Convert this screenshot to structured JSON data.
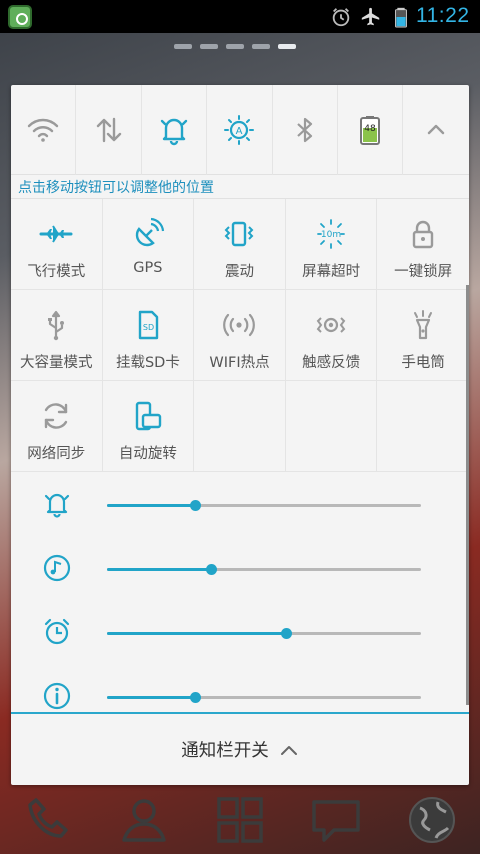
{
  "status_bar": {
    "time": "11:22",
    "icons": [
      "alarm-icon",
      "airplane-mode-icon",
      "battery-icon"
    ],
    "app_icon": "notification-app-icon"
  },
  "pager": {
    "pages": 5,
    "active_index": 4
  },
  "quick_toggles": [
    {
      "name": "wifi-toggle",
      "icon": "wifi-icon",
      "active": false
    },
    {
      "name": "data-sync-toggle",
      "icon": "mobile-data-icon",
      "active": false
    },
    {
      "name": "ringtone-toggle",
      "icon": "bell-icon",
      "active": true
    },
    {
      "name": "auto-brightness-toggle",
      "icon": "auto-brightness-icon",
      "active": true
    },
    {
      "name": "bluetooth-toggle",
      "icon": "bluetooth-icon",
      "active": false
    },
    {
      "name": "battery-toggle",
      "icon": "battery-icon",
      "value": "48"
    },
    {
      "name": "collapse-toggle",
      "icon": "chevron-up-icon"
    }
  ],
  "hint_text": "点击移动按钮可以调整他的位置",
  "tiles": [
    {
      "label": "飞行模式",
      "icon": "airplane-icon",
      "active": true
    },
    {
      "label": "GPS",
      "icon": "satellite-icon",
      "active": true
    },
    {
      "label": "震动",
      "icon": "vibrate-icon",
      "active": true
    },
    {
      "label": "屏幕超时",
      "icon": "screen-timeout-icon",
      "active": true,
      "badge": "10m"
    },
    {
      "label": "一键锁屏",
      "icon": "lock-icon",
      "active": false
    },
    {
      "label": "大容量模式",
      "icon": "usb-icon",
      "active": false
    },
    {
      "label": "挂载SD卡",
      "icon": "sd-card-icon",
      "active": true,
      "badge": "SD"
    },
    {
      "label": "WIFI热点",
      "icon": "hotspot-icon",
      "active": false
    },
    {
      "label": "触感反馈",
      "icon": "haptic-icon",
      "active": false
    },
    {
      "label": "手电筒",
      "icon": "flashlight-icon",
      "active": false
    },
    {
      "label": "网络同步",
      "icon": "sync-icon",
      "active": false
    },
    {
      "label": "自动旋转",
      "icon": "rotate-icon",
      "active": true
    }
  ],
  "sliders": [
    {
      "name": "ringtone-volume",
      "icon": "bell-icon",
      "value": 0.28
    },
    {
      "name": "media-volume",
      "icon": "music-note-icon",
      "value": 0.33
    },
    {
      "name": "alarm-volume",
      "icon": "alarm-clock-icon",
      "value": 0.57
    },
    {
      "name": "system-volume",
      "icon": "info-icon",
      "value": 0.28
    }
  ],
  "footer": {
    "label": "通知栏开关",
    "icon": "chevron-up-icon"
  },
  "dock": [
    "phone-icon",
    "contacts-icon",
    "app-drawer-icon",
    "messages-icon",
    "browser-globe-icon"
  ],
  "colors": {
    "accent": "#21a4c8",
    "hint": "#1d8fbd",
    "inactive": "#9a9a9a",
    "panel": "#f4f4f4"
  }
}
